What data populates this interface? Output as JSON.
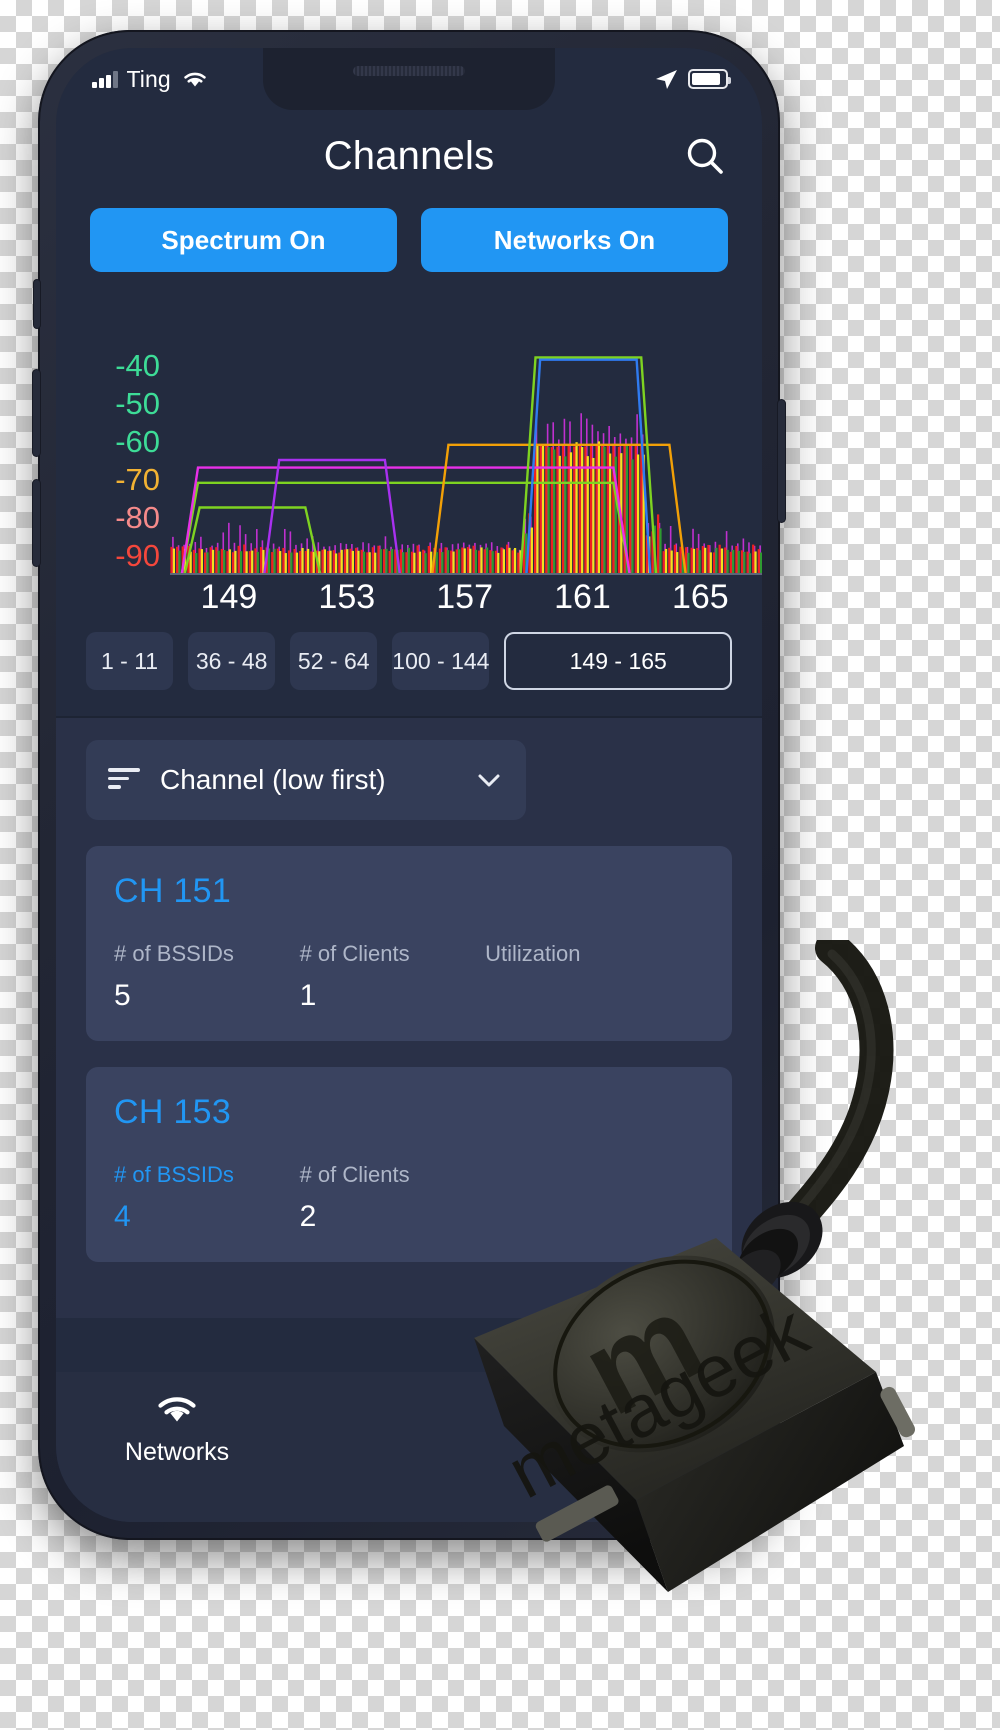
{
  "status_bar": {
    "carrier": "Ting",
    "signal_icon": "cellular-bars-icon",
    "wifi_icon": "wifi-icon",
    "location_icon": "location-arrow-icon",
    "battery_icon": "battery-icon"
  },
  "header": {
    "title": "Channels",
    "search_icon": "search-icon"
  },
  "toggles": [
    {
      "label": "Spectrum On",
      "name": "spectrum-toggle-button",
      "color": "#2196f3"
    },
    {
      "label": "Networks On",
      "name": "networks-toggle-button",
      "color": "#2196f3"
    }
  ],
  "chart_data": {
    "type": "line",
    "title": "",
    "xlabel": "",
    "ylabel": "",
    "grid": false,
    "legend": "none",
    "ylim": [
      -95,
      -35
    ],
    "xlim": [
      147,
      167.5
    ],
    "ytick_labels": [
      "-40",
      "-50",
      "-60",
      "-70",
      "-80",
      "-90"
    ],
    "ytick_values": [
      -40,
      -50,
      -60,
      -70,
      -80,
      -90
    ],
    "ytick_colors": [
      "#3ddc97",
      "#3ddc97",
      "#3ddc97",
      "#f2b233",
      "#f58a8a",
      "#f4473c"
    ],
    "xtick_labels": [
      "149",
      "153",
      "157",
      "161",
      "165"
    ],
    "xtick_values": [
      149,
      153,
      157,
      161,
      165
    ],
    "series": [
      {
        "name": "network-green-1",
        "color": "#7ed321",
        "type": "trapezoid",
        "center": 149.8,
        "half_width": 2.3,
        "level": -77.5
      },
      {
        "name": "network-green-2",
        "color": "#7ed321",
        "type": "trapezoid",
        "center": 155.0,
        "half_width": 7.6,
        "level": -71.0
      },
      {
        "name": "network-magenta-1",
        "color": "#e830e8",
        "type": "trapezoid",
        "center": 155.0,
        "half_width": 7.6,
        "level": -67.0
      },
      {
        "name": "network-purple-1",
        "color": "#a830f0",
        "type": "trapezoid",
        "center": 152.5,
        "half_width": 2.3,
        "level": -65.0
      },
      {
        "name": "network-orange-1",
        "color": "#f2a007",
        "type": "trapezoid",
        "center": 160.2,
        "half_width": 4.3,
        "level": -61.0
      },
      {
        "name": "network-green-3",
        "color": "#7ed321",
        "type": "trapezoid",
        "center": 161.2,
        "half_width": 2.3,
        "level": -38.0
      },
      {
        "name": "network-blue-1",
        "color": "#2f7bf0",
        "type": "trapezoid",
        "center": 161.2,
        "half_width": 2.1,
        "level": -38.6
      }
    ],
    "spectrum": {
      "description": "Live spectrum density bars; red = max hold, green/yellow = average, magenta = peaks",
      "colors": {
        "max": "#ef2020",
        "avg_green": "#2e9b30",
        "avg_yellow": "#f2e31c",
        "peak": "#c030d0"
      },
      "noise_floor": -90,
      "strong_region": [
        159.4,
        163.1
      ],
      "strong_region_top": -60
    }
  },
  "range_buttons": [
    {
      "label": "1 - 11",
      "name": "range-1-11-button",
      "selected": false
    },
    {
      "label": "36 - 48",
      "name": "range-36-48-button",
      "selected": false
    },
    {
      "label": "52 - 64",
      "name": "range-52-64-button",
      "selected": false
    },
    {
      "label": "100 - 144",
      "name": "range-100-144-button",
      "selected": false
    },
    {
      "label": "149 - 165",
      "name": "range-149-165-button",
      "selected": true
    }
  ],
  "sort": {
    "label": "Channel (low first)",
    "sort_icon": "sort-lines-icon",
    "chevron_icon": "chevron-down-icon"
  },
  "channel_cards": [
    {
      "title": "CH 151",
      "stats": [
        {
          "label": "# of BSSIDs",
          "value": "5",
          "highlight": false
        },
        {
          "label": "# of Clients",
          "value": "1",
          "highlight": false
        },
        {
          "label": "Utilization",
          "value": "",
          "highlight": false
        }
      ]
    },
    {
      "title": "CH 153",
      "stats": [
        {
          "label": "# of BSSIDs",
          "value": "4",
          "highlight": true
        },
        {
          "label": "# of Clients",
          "value": "2",
          "highlight": false
        },
        {
          "label": "",
          "value": "",
          "highlight": false
        }
      ]
    }
  ],
  "bottom_nav": [
    {
      "label": "Networks",
      "icon": "wifi-icon",
      "name": "nav-item-networks",
      "active": true
    }
  ],
  "device": {
    "brand_text": "metageek",
    "name": "metageek-wifi-spectrum-analyzer-dongle"
  },
  "colors": {
    "accent": "#2196f3",
    "screen_bg": "#232b3f",
    "list_bg": "#2a3148",
    "card_bg": "#3a4360"
  }
}
